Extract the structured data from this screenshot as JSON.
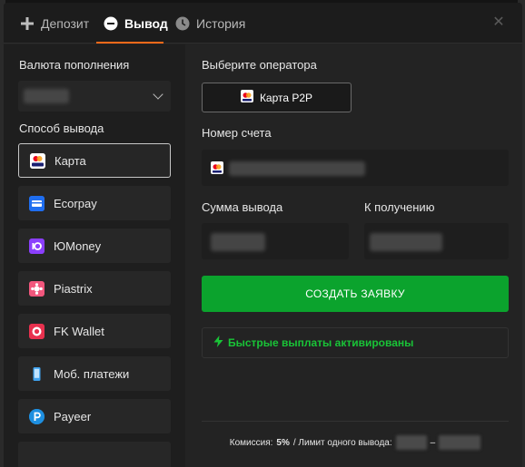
{
  "tabs": [
    {
      "label": "Депозит",
      "icon": "plus-icon"
    },
    {
      "label": "Вывод",
      "icon": "minus-circle-icon"
    },
    {
      "label": "История",
      "icon": "clock-icon"
    }
  ],
  "active_tab": "Вывод",
  "colors": {
    "accent": "#ff6a1a",
    "primary_button": "#0ba32d",
    "success_text": "#19c437"
  },
  "currency": {
    "label": "Валюта пополнения",
    "value_hidden": true
  },
  "methods": {
    "label": "Способ вывода",
    "items": [
      {
        "label": "Карта",
        "icon": "visa-card-icon",
        "selected": true
      },
      {
        "label": "Ecorpay",
        "icon": "ecorpay-icon"
      },
      {
        "label": "ЮMoney",
        "icon": "yumoney-icon"
      },
      {
        "label": "Piastrix",
        "icon": "piastrix-icon"
      },
      {
        "label": "FK Wallet",
        "icon": "fkwallet-icon"
      },
      {
        "label": "Моб. платежи",
        "icon": "phone-icon"
      },
      {
        "label": "Payeer",
        "icon": "payeer-icon"
      }
    ]
  },
  "operator": {
    "label": "Выберите оператора",
    "button_label": "Карта P2P",
    "icon": "mastercard-icon"
  },
  "account": {
    "label": "Номер счета",
    "icon": "mastercard-icon"
  },
  "amount": {
    "label": "Сумма вывода"
  },
  "receive": {
    "label": "К получению"
  },
  "create_button": "СОЗДАТЬ ЗАЯВКУ",
  "fast_payouts": "Быстрые выплаты активированы",
  "footer": {
    "commission_label": "Комиссия:",
    "commission_value": "5%",
    "limit_label": "/ Лимит одного вывода:",
    "range_sep": "–"
  }
}
